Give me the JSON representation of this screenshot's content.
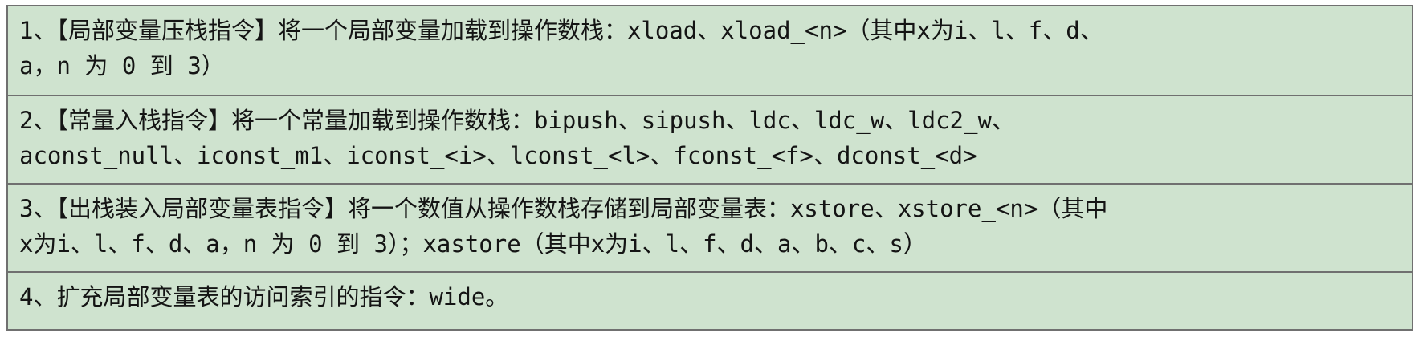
{
  "table": {
    "rows": [
      {
        "line1": "1、【局部变量压栈指令】将一个局部变量加载到操作数栈：xload、xload_<n>（其中x为i、l、f、d、",
        "line2": "a，n 为 0 到 3）"
      },
      {
        "line1": "2、【常量入栈指令】将一个常量加载到操作数栈：bipush、sipush、ldc、ldc_w、ldc2_w、",
        "line2": "aconst_null、iconst_m1、iconst_<i>、lconst_<l>、fconst_<f>、dconst_<d>"
      },
      {
        "line1": "3、【出栈装入局部变量表指令】将一个数值从操作数栈存储到局部变量表：xstore、xstore_<n>（其中",
        "line2": "x为i、l、f、d、a，n 为 0 到 3）；xastore（其中x为i、l、f、d、a、b、c、s）"
      },
      {
        "line1": "4、扩充局部变量表的访问索引的指令：wide。"
      }
    ]
  },
  "colors": {
    "background": "#cfe3cf",
    "border": "#707070",
    "text": "#141414"
  }
}
